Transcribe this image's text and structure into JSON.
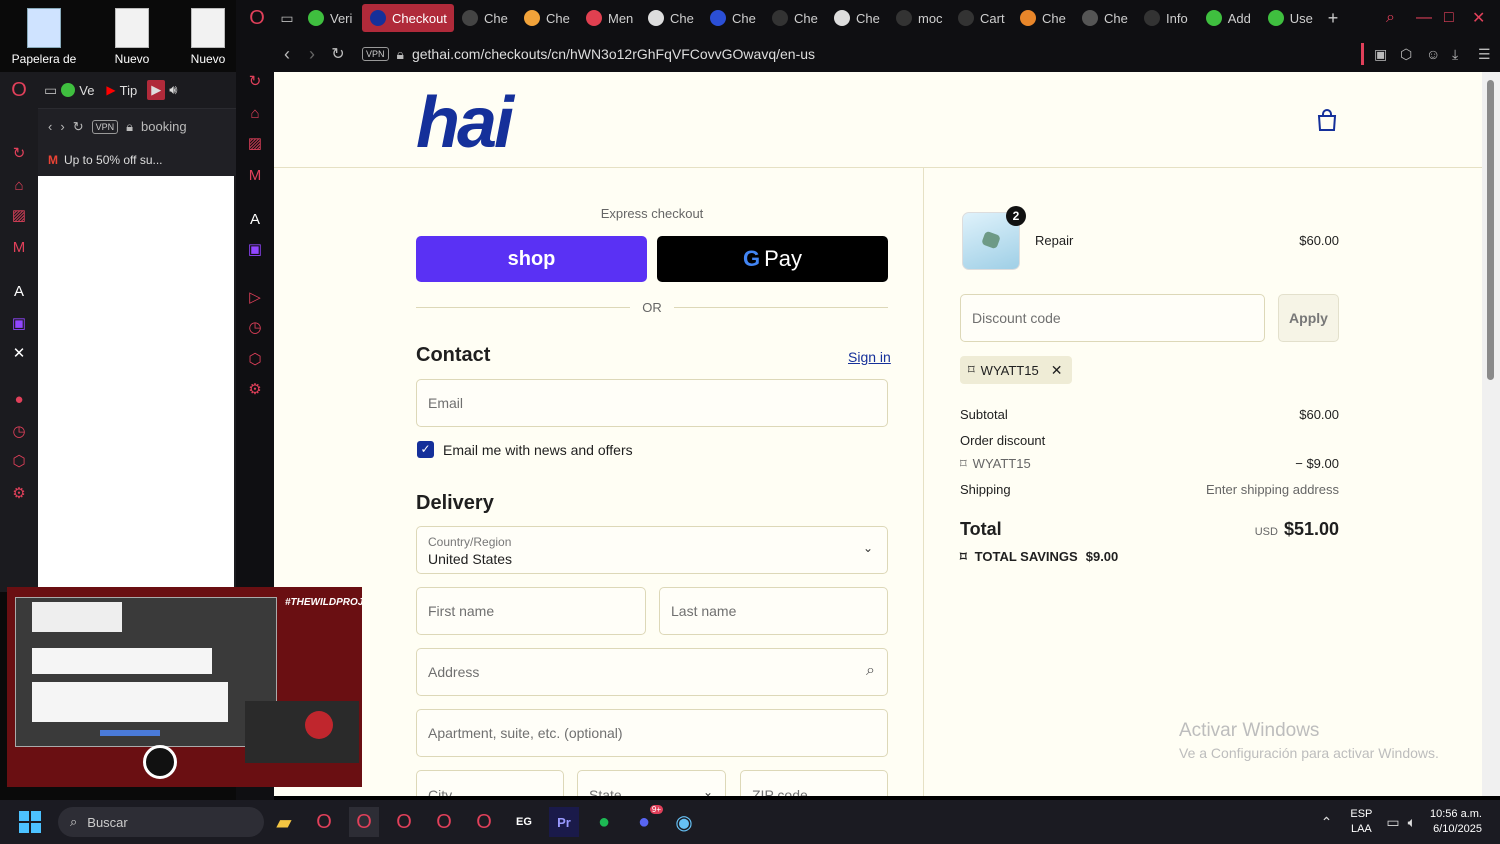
{
  "desktop": {
    "icons": [
      {
        "label": "Papelera de"
      },
      {
        "label": "Nuevo"
      },
      {
        "label": "Nuevo"
      }
    ]
  },
  "window2": {
    "tabs": [
      {
        "label": "Ve"
      },
      {
        "label": "Tip"
      }
    ],
    "address": "booking",
    "bookmark": "Up to 50% off su..."
  },
  "browser": {
    "tabs": [
      {
        "label": "Veri",
        "color": "#3fbf3f"
      },
      {
        "label": "Checkout",
        "color": "#15309a",
        "active": true
      },
      {
        "label": "Che",
        "color": "#444"
      },
      {
        "label": "Che",
        "color": "#f2a33a"
      },
      {
        "label": "Men",
        "color": "#e04050"
      },
      {
        "label": "Che",
        "color": "#ddd"
      },
      {
        "label": "Che",
        "color": "#2b4fd6"
      },
      {
        "label": "Che",
        "color": "#333"
      },
      {
        "label": "Che",
        "color": "#ddd"
      },
      {
        "label": "moc",
        "color": "#333"
      },
      {
        "label": "Cart",
        "color": "#333"
      },
      {
        "label": "Che",
        "color": "#e8862a"
      },
      {
        "label": "Che",
        "color": "#555"
      },
      {
        "label": "Info",
        "color": "#333"
      },
      {
        "label": "Add",
        "color": "#3fbf3f"
      },
      {
        "label": "Use",
        "color": "#3fbf3f"
      }
    ],
    "url": "gethai.com/checkouts/cn/hWN3o12rGhFqVFCovvGOwavq/en-us",
    "vpn_label": "VPN"
  },
  "checkout": {
    "logo": "hai",
    "express_label": "Express checkout",
    "shop_label": "shop",
    "gpay_label": "Pay",
    "gpay_g": "G",
    "or_label": "OR",
    "contact_title": "Contact",
    "sign_in": "Sign in",
    "email_placeholder": "Email",
    "news_label": "Email me with news and offers",
    "delivery_title": "Delivery",
    "country_label": "Country/Region",
    "country_value": "United States",
    "first_name": "First name",
    "last_name": "Last name",
    "address": "Address",
    "apartment": "Apartment, suite, etc. (optional)",
    "city": "City",
    "state": "State",
    "zip": "ZIP code"
  },
  "summary": {
    "item_qty": "2",
    "item_name": "Repair",
    "item_price": "$60.00",
    "discount_placeholder": "Discount code",
    "apply_label": "Apply",
    "applied_code": "WYATT15",
    "subtotal_label": "Subtotal",
    "subtotal_value": "$60.00",
    "order_discount_label": "Order discount",
    "discount_code": "WYATT15",
    "discount_value": "− $9.00",
    "shipping_label": "Shipping",
    "shipping_value": "Enter shipping address",
    "total_label": "Total",
    "currency": "USD",
    "total_value": "$51.00",
    "savings_label": "TOTAL SAVINGS",
    "savings_value": "$9.00"
  },
  "watermark": {
    "title": "Activar Windows",
    "subtitle": "Ve a Configuración para activar Windows."
  },
  "stream": {
    "tag": "#THEWILDPROJECT"
  },
  "taskbar": {
    "search": "Buscar",
    "lang_top": "ESP",
    "lang_bottom": "LAA",
    "time": "10:56 a.m.",
    "date": "6/10/2025",
    "discord_badge": "9+"
  }
}
